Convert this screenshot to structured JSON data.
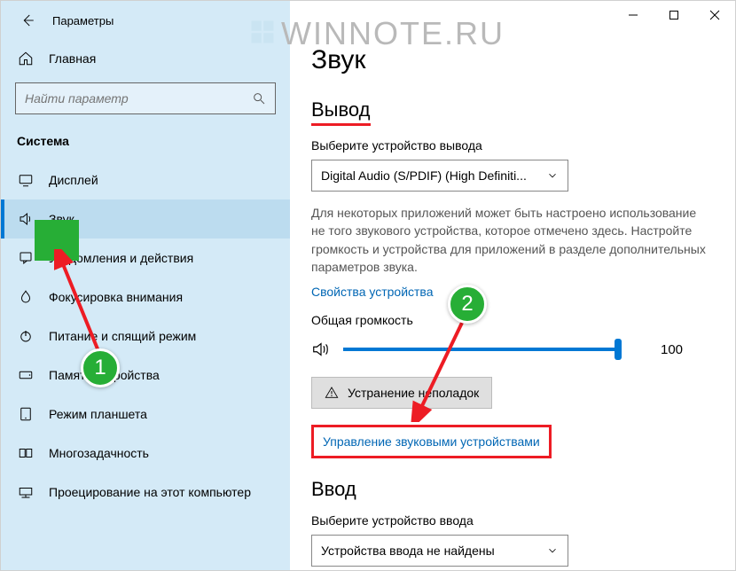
{
  "titlebar": {
    "title": "Параметры"
  },
  "sidebar": {
    "home": "Главная",
    "search_placeholder": "Найти параметр",
    "section": "Система",
    "items": [
      {
        "label": "Дисплей"
      },
      {
        "label": "Звук"
      },
      {
        "label": "Уведомления и действия"
      },
      {
        "label": "Фокусировка внимания"
      },
      {
        "label": "Питание и спящий режим"
      },
      {
        "label": "Память устройства"
      },
      {
        "label": "Режим планшета"
      },
      {
        "label": "Многозадачность"
      },
      {
        "label": "Проецирование на этот компьютер"
      }
    ]
  },
  "main": {
    "heading": "Звук",
    "output_section": "Вывод",
    "output_label": "Выберите устройство вывода",
    "output_device": "Digital Audio (S/PDIF) (High Definiti...",
    "output_desc": "Для некоторых приложений может быть настроено использование не того звукового устройства, которое отмечено здесь. Настройте громкость и устройства для приложений в разделе дополнительных параметров звука.",
    "device_props": "Свойства устройства",
    "volume_label": "Общая громкость",
    "volume_value": "100",
    "troubleshoot": "Устранение неполадок",
    "manage_devices": "Управление звуковыми устройствами",
    "input_section": "Ввод",
    "input_label": "Выберите устройство ввода",
    "input_device": "Устройства ввода не найдены"
  },
  "watermark": "WINNOTE.RU",
  "markers": {
    "one": "1",
    "two": "2"
  }
}
